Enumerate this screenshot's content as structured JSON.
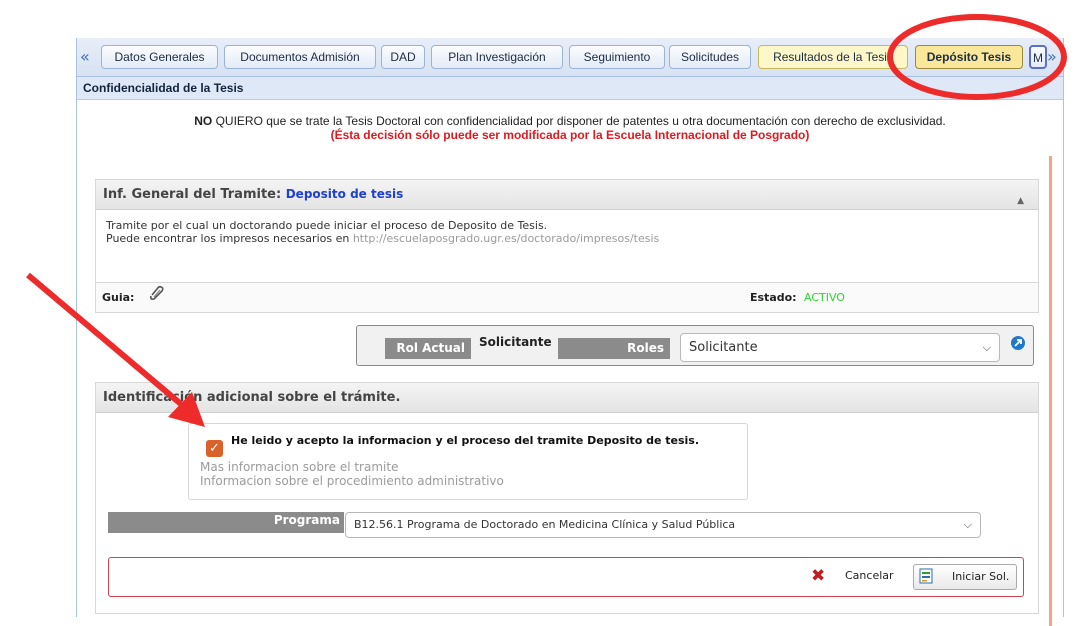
{
  "tabs": {
    "prev_arrow": "«",
    "next_arrow": "»",
    "items": [
      {
        "label": "Datos Generales"
      },
      {
        "label": "Documentos Admisión"
      },
      {
        "label": "DAD"
      },
      {
        "label": "Plan Investigación"
      },
      {
        "label": "Seguimiento"
      },
      {
        "label": "Solicitudes"
      },
      {
        "label": "Resultados de la Tesis"
      },
      {
        "label": "Depósito Tesis"
      },
      {
        "label": "M"
      }
    ]
  },
  "section": {
    "title": "Confidencialidad de la Tesis"
  },
  "notice": {
    "no": "NO",
    "text": "QUIERO que se trate la Tesis Doctoral con confidencialidad por disponer de patentes u otra documentación con derecho de exclusividad.",
    "warning": "(Ésta decisión sólo puede ser modificada por la Escuela Internacional de Posgrado)"
  },
  "info_panel": {
    "label": "Inf. General del Tramite:",
    "name": "Deposito de tesis",
    "line1": "Tramite por el cual un doctorando puede iniciar el proceso de Deposito de Tesis.",
    "line2_prefix": "Puede encontrar los impresos necesarios en ",
    "line2_link": "http://escuelaposgrado.ugr.es/doctorado/impresos/tesis",
    "guia_label": "Guia:",
    "estado_label": "Estado:",
    "estado_value": "ACTIVO",
    "estado_color": "#2fd52f"
  },
  "roles": {
    "rol_actual_label": "Rol Actual",
    "rol_actual_value": "Solicitante",
    "roles_label": "Roles",
    "roles_selected": "Solicitante"
  },
  "identification": {
    "title": "Identificación adicional sobre el trámite.",
    "ack_text": "He leido y acepto la informacion y el proceso del tramite Deposito de tesis.",
    "ack_checked": true,
    "more_info": "Mas informacion sobre el tramite",
    "procedure_info": "Informacion sobre el procedimiento administrativo",
    "program_label": "Programa",
    "program_selected": "B12.56.1 Programa de Doctorado en Medicina Clínica y Salud Pública"
  },
  "actions": {
    "cancel_label": "Cancelar",
    "start_label": "Iniciar Sol."
  },
  "annotation_color": "#ee2b2b"
}
